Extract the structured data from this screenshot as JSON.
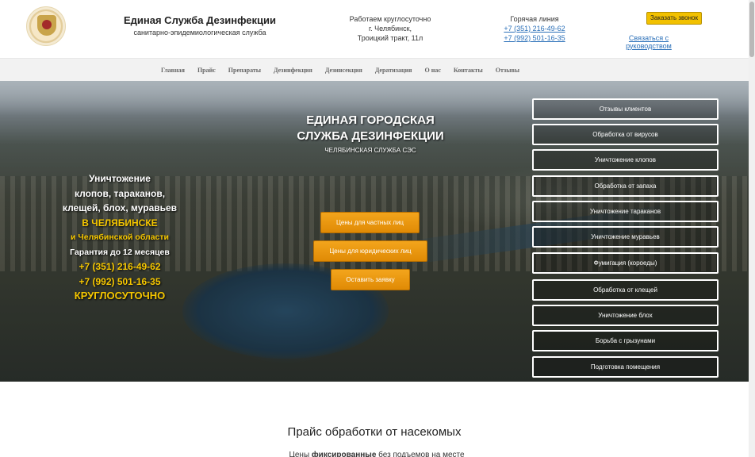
{
  "header": {
    "brand_title": "Единая Служба Дезинфекции",
    "brand_subtitle": "санитарно-эпидемиологическая служба",
    "hours_line1": "Работаем круглосуточно",
    "hours_line2": "г. Челябинск,",
    "hours_line3": "Троицкий тракт, 11л",
    "hotline_label": "Горячая линия",
    "phone1": "+7 (351) 216-49-62",
    "phone2": "+7 (992) 501-16-35",
    "order_call": "Заказать звонок",
    "contact_manager": "Связаться с руководством",
    "logo_icon": "emblem-icon"
  },
  "nav": {
    "items": [
      "Главная",
      "Прайс",
      "Препараты",
      "Дезинфекция",
      "Дезинсекция",
      "Дератизация",
      "О нас",
      "Контакты",
      "Отзывы"
    ]
  },
  "hero": {
    "title_line1": "ЕДИНАЯ ГОРОДСКАЯ",
    "title_line2": "СЛУЖБА ДЕЗИНФЕКЦИИ",
    "subtitle": "ЧЕЛЯБИНСКАЯ СЛУЖБА СЭС",
    "left": {
      "line1": "Уничтожение",
      "line2": "клопов, тараканов,",
      "line3": "клещей, блох, муравьев",
      "line4": "В ЧЕЛЯБИНСКЕ",
      "line5": "и Челябинской области",
      "line6": "Гарантия до 12 месяцев",
      "line7": "+7 (351) 216-49-62",
      "line8": "+7 (992) 501-16-35",
      "line9": "КРУГЛОСУТОЧНО"
    },
    "cta": {
      "private_prices": "Цены для частных лиц",
      "legal_prices": "Цены для юридических лиц",
      "leave_request": "Оставить заявку"
    },
    "services": [
      "Отзывы клиентов",
      "Обработка от вирусов",
      "Уничтожение клопов",
      "Обработка от запаха",
      "Уничтожение тараканов",
      "Уничтожение муравьев",
      "Фумигация (короеды)",
      "Обработка от клещей",
      "Уничтожение блох",
      "Борьба с грызунами",
      "Подготовка помещения"
    ]
  },
  "price_section": {
    "title": "Прайс обработки от насекомых",
    "text_start": "Цены",
    "text_bold": "фиксированные",
    "text_end": "без подъемов на месте"
  },
  "colors": {
    "accent_yellow": "#f2c100",
    "cta_orange": "#e08a05",
    "link_blue": "#2a6fb8",
    "hero_highlight": "#f6c700"
  }
}
